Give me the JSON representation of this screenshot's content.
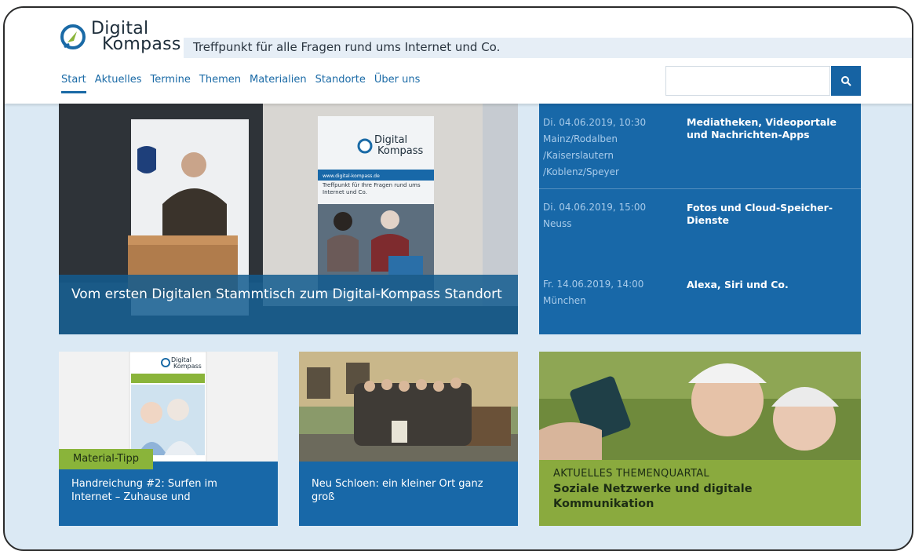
{
  "site": {
    "logo_line1": "Digital",
    "logo_line2": "Kompass",
    "tagline": "Treffpunkt für alle Fragen rund ums Internet und Co."
  },
  "nav": {
    "items": [
      {
        "label": "Start",
        "active": true
      },
      {
        "label": "Aktuelles"
      },
      {
        "label": "Termine"
      },
      {
        "label": "Themen"
      },
      {
        "label": "Materialien"
      },
      {
        "label": "Standorte"
      },
      {
        "label": "Über uns"
      }
    ]
  },
  "search": {
    "placeholder": "",
    "icon": "search-icon"
  },
  "hero": {
    "caption": "Vom ersten Digitalen Stammtisch zum Digital-Kompass Standort",
    "banner_logo_line1": "Digital",
    "banner_logo_line2": "Kompass",
    "banner_url": "www.digital-kompass.de",
    "banner_tagline": "Treffpunkt für Ihre Fragen rund ums Internet und Co."
  },
  "events": [
    {
      "datetime": "Di. 04.06.2019, 10:30",
      "place": "Mainz/Rodalben /Kaiserslautern /Koblenz/Speyer",
      "title": "Mediatheken, Videoportale und Nachrichten-Apps"
    },
    {
      "datetime": "Di. 04.06.2019, 15:00",
      "place": "Neuss",
      "title": "Fotos und Cloud-Speicher-Dienste"
    },
    {
      "datetime": "Fr. 14.06.2019, 14:00",
      "place": "München",
      "title": "Alexa, Siri und Co."
    }
  ],
  "cards": {
    "material": {
      "tag": "Material-Tipp",
      "text": "Handreichung #2: Surfen im Internet – Zuhause und",
      "cover_logo_line1": "Digital",
      "cover_logo_line2": "Kompass"
    },
    "news": {
      "text": "Neu Schloen: ein kleiner Ort ganz groß"
    },
    "quartal": {
      "pretitle": "AKTUELLES THEMENQUARTAL",
      "title": "Soziale Netzwerke und digitale Kommunikation"
    }
  },
  "colors": {
    "brand_blue": "#1868a8",
    "accent_green": "#8ab43a",
    "background": "#dbe9f4"
  }
}
